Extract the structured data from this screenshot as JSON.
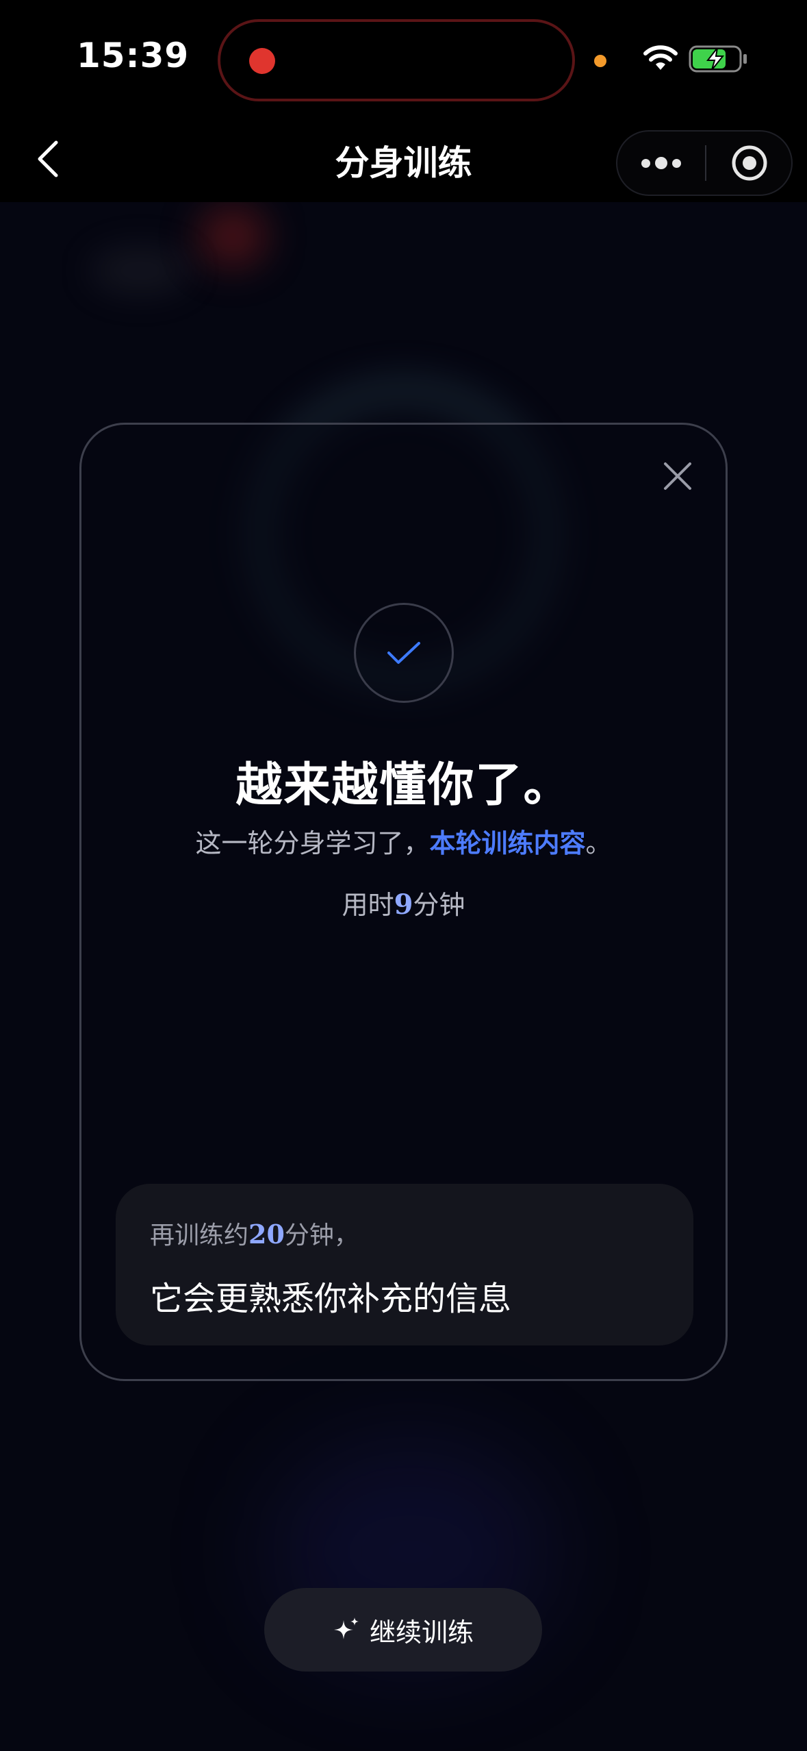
{
  "status_bar": {
    "time": "15:39"
  },
  "nav": {
    "title": "分身训练",
    "back_icon": "chevron-left-icon",
    "more_icon": "more-dots-icon",
    "target_icon": "target-icon"
  },
  "dialog": {
    "close_icon": "close-icon",
    "check_icon": "check-icon",
    "headline": "越来越懂你了。",
    "subline_prefix": "这一轮分身学习了，",
    "subline_highlight": "本轮训练内容",
    "subline_suffix": "。",
    "duration_prefix": "用时",
    "duration_value": "9",
    "duration_suffix": "分钟",
    "info": {
      "line1_prefix": "再训练约",
      "line1_value": "20",
      "line1_suffix": "分钟，",
      "line2": "它会更熟悉你补充的信息"
    }
  },
  "continue_button": {
    "icon": "sparkle-icon",
    "label": "继续训练"
  },
  "colors": {
    "accent": "#4d7cff",
    "number_accent": "#8fa8ff",
    "background": "#050611"
  }
}
